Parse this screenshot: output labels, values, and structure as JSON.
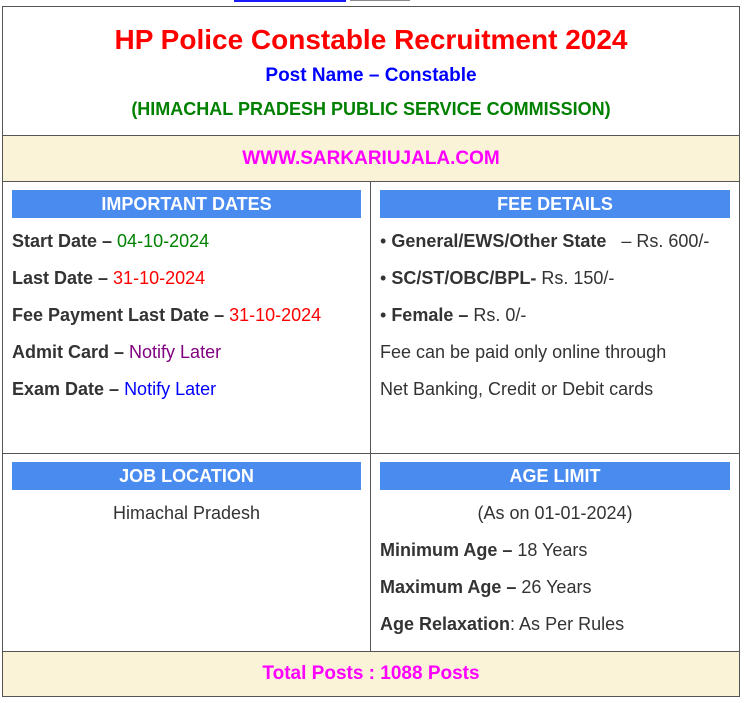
{
  "header": {
    "title": "HP Police Constable Recruitment 2024",
    "post_name": "Post Name – Constable",
    "commission": "(HIMACHAL PRADESH PUBLIC SERVICE COMMISSION)"
  },
  "website": "WWW.SARKARIUJALA.COM",
  "important_dates": {
    "heading": "IMPORTANT DATES",
    "items": [
      {
        "label": "Start Date – ",
        "value": "04-10-2024"
      },
      {
        "label": "Last Date – ",
        "value": "31-10-2024"
      },
      {
        "label": "Fee Payment Last Date – ",
        "value": "31-10-2024"
      },
      {
        "label": "Admit Card – ",
        "value": "Notify Later"
      },
      {
        "label": "Exam Date – ",
        "value": "Notify Later"
      }
    ]
  },
  "fee_details": {
    "heading": "FEE DETAILS",
    "items": [
      {
        "label": "General/EWS/Other State",
        "value": "   – Rs. 600/-"
      },
      {
        "label": "SC/ST/OBC/BPL-",
        "value": " Rs. 150/-"
      },
      {
        "label": "Female –",
        "value": " Rs. 0/-"
      }
    ],
    "bullet": "• ",
    "note_line1": "Fee can be paid only online through",
    "note_line2": "Net Banking, Credit or Debit cards"
  },
  "job_location": {
    "heading": "JOB LOCATION",
    "value": "Himachal Pradesh"
  },
  "age_limit": {
    "heading": "AGE LIMIT",
    "as_on": "(As on 01-01-2024)",
    "items": [
      {
        "label": "Minimum Age –",
        "value": " 18 Years"
      },
      {
        "label": "Maximum Age –",
        "value": " 26 Years"
      },
      {
        "label": "Age Relaxation",
        "value": ": As Per Rules"
      }
    ]
  },
  "total_posts": "Total Posts : 1088 Posts",
  "colors": {
    "title": "#ff0000",
    "post_name": "#0000ff",
    "commission": "#008000",
    "website": "#ff00ff",
    "section_bar": "#4a8bf0",
    "highlight_row": "#fbf3d8"
  }
}
